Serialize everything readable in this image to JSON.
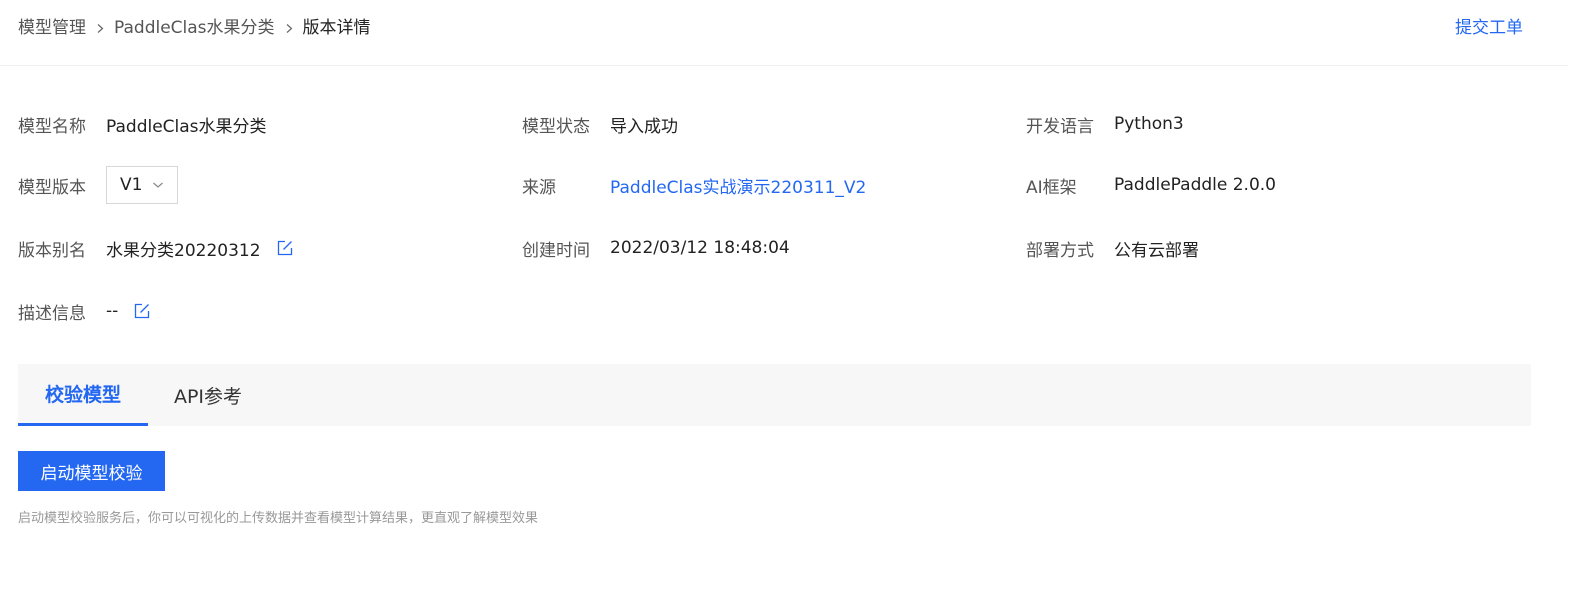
{
  "header": {
    "breadcrumb": [
      "模型管理",
      "PaddleClas水果分类",
      "版本详情"
    ],
    "submit_ticket": "提交工单"
  },
  "details": {
    "model_name": {
      "label": "模型名称",
      "value": "PaddleClas水果分类"
    },
    "model_status": {
      "label": "模型状态",
      "value": "导入成功"
    },
    "dev_language": {
      "label": "开发语言",
      "value": "Python3"
    },
    "model_version": {
      "label": "模型版本",
      "value": "V1"
    },
    "source": {
      "label": "来源",
      "value": "PaddleClas实战演示220311_V2"
    },
    "ai_framework": {
      "label": "AI框架",
      "value": "PaddlePaddle 2.0.0"
    },
    "version_alias": {
      "label": "版本别名",
      "value": "水果分类20220312"
    },
    "created_time": {
      "label": "创建时间",
      "value": "2022/03/12 18:48:04"
    },
    "deploy_method": {
      "label": "部署方式",
      "value": "公有云部署"
    },
    "description": {
      "label": "描述信息",
      "value": "--"
    }
  },
  "tabs": [
    {
      "label": "校验模型",
      "active": true
    },
    {
      "label": "API参考",
      "active": false
    }
  ],
  "validation": {
    "start_button": "启动模型校验",
    "hint": "启动模型校验服务后，你可以可视化的上传数据并查看模型计算结果，更直观了解模型效果"
  },
  "colors": {
    "accent": "#2468f2",
    "label": "#555555",
    "hint": "#999999"
  },
  "icons": {
    "breadcrumb_separator": "chevron-right-icon",
    "edit": "edit-icon",
    "select_arrow": "chevron-down-icon"
  }
}
